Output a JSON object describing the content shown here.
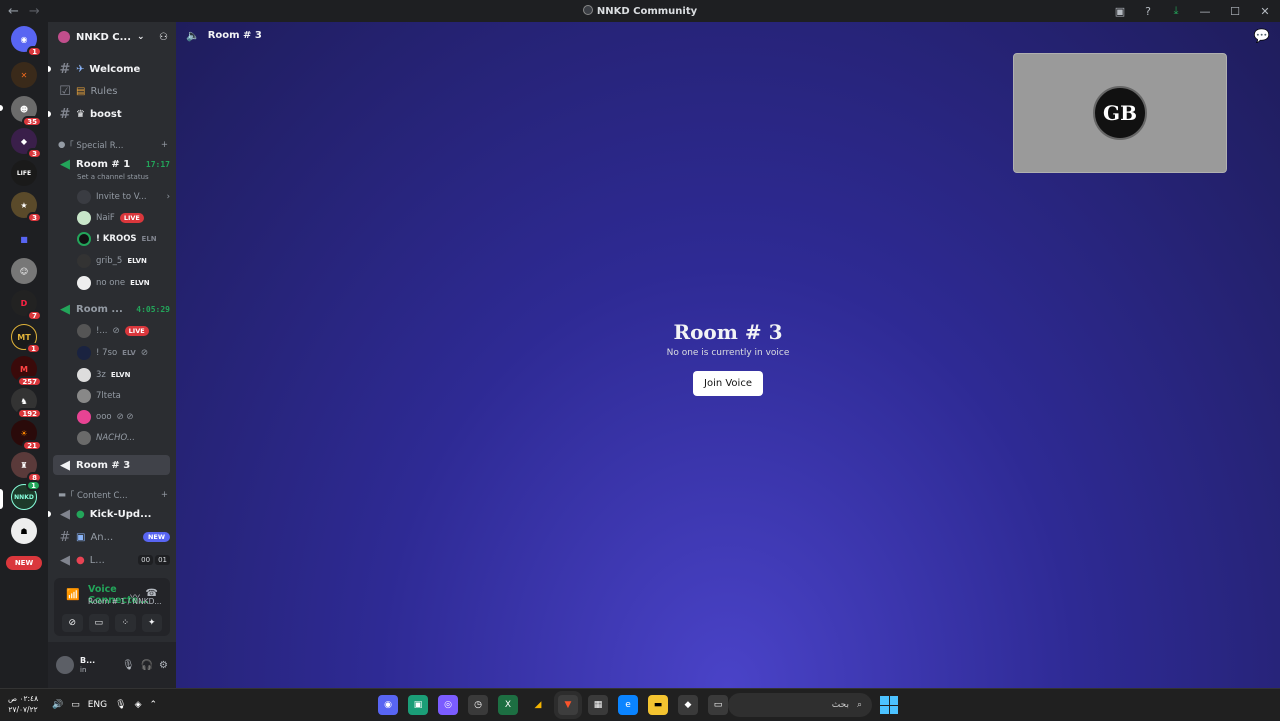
{
  "window": {
    "title": "NNKD Community",
    "back": "←",
    "forward": "→"
  },
  "server_badges": [
    "1",
    "35",
    "3",
    "3",
    "7",
    "1",
    "257",
    "192",
    "21",
    "8",
    "1"
  ],
  "new_label": "NEW",
  "sidebar": {
    "server_name": "NNKD C...",
    "channels": {
      "welcome": "Welcome",
      "rules": "Rules",
      "boost": "boost",
      "cat1": "｢ Special R...",
      "room1": "Room # 1",
      "room1_timer": "17:17",
      "room1_status": "Set a channel status",
      "invite": "Invite to V...",
      "room2": "Room ...",
      "room2_timer": "4:05:29",
      "room3": "Room # 3",
      "cat2": "｢ Content C...",
      "kick": "Kick-Upd...",
      "an": "An...",
      "an_tag": "NEW",
      "l": "L...",
      "l_counts": [
        "00",
        "01"
      ]
    },
    "members_room1": [
      {
        "name": "NaiF",
        "tag": "LIVE"
      },
      {
        "name": "! KROOS",
        "tag": "ELN"
      },
      {
        "name": "grib_5",
        "tag": "ELVN"
      },
      {
        "name": "no one",
        "tag": "ELVN"
      }
    ],
    "members_room2": [
      {
        "name": "!...",
        "tag": "LIVE"
      },
      {
        "name": "! 7so",
        "tag": "ELV"
      },
      {
        "name": "3z",
        "tag": "ELVN"
      },
      {
        "name": "7lteta",
        "tag": ""
      },
      {
        "name": "ooo",
        "tag": ""
      },
      {
        "name": "NACHO...",
        "tag": ""
      }
    ],
    "voice": {
      "title": "Voice Connecte...",
      "sub": "Room # 1 / NNKD..."
    },
    "user": {
      "name": "B...",
      "status": "in"
    }
  },
  "main": {
    "header": "Room # 3",
    "room_title": "Room # 3",
    "room_sub": "No one is currently in voice",
    "join_label": "Join Voice",
    "tile_logo": "GB"
  },
  "taskbar": {
    "time": "٠٢:٤٨ ص",
    "date": "٢٧/٠٧/٢٢",
    "lang": "ENG",
    "search": "بحث"
  }
}
